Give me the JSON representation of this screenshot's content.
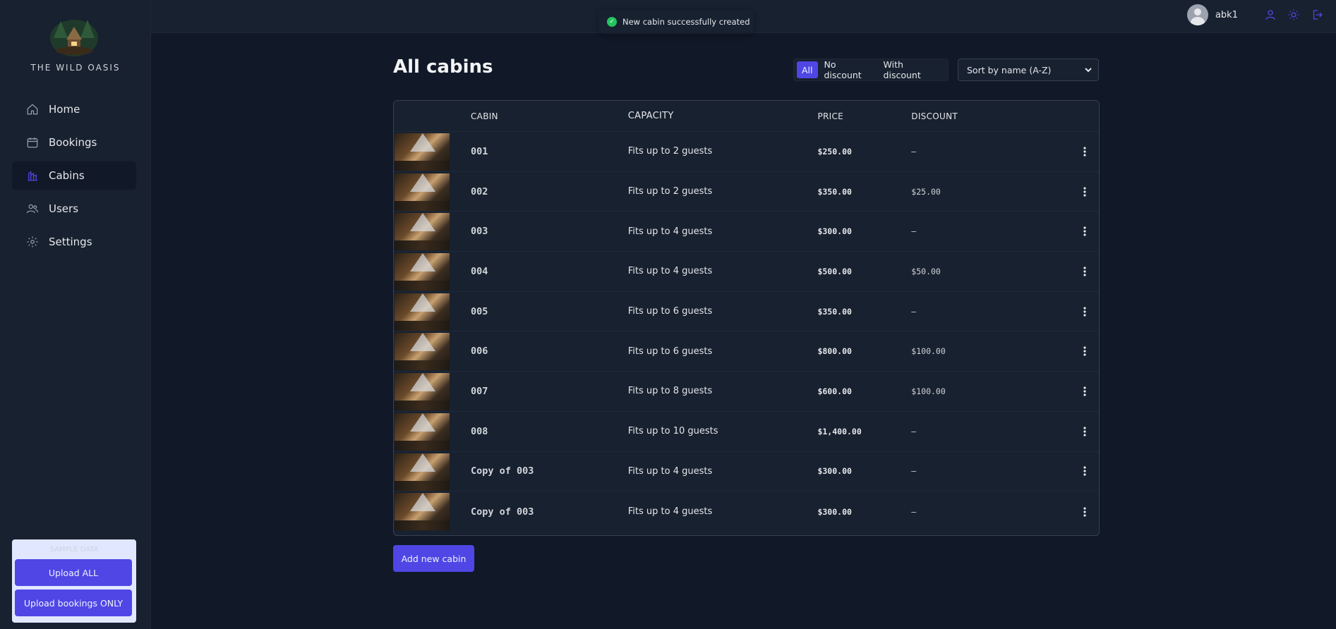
{
  "brand": {
    "name": "THE WILD OASIS"
  },
  "sidebar": {
    "items": [
      {
        "label": "Home",
        "icon": "home-icon",
        "active": false
      },
      {
        "label": "Bookings",
        "icon": "calendar-icon",
        "active": false
      },
      {
        "label": "Cabins",
        "icon": "cabins-icon",
        "active": true
      },
      {
        "label": "Users",
        "icon": "users-icon",
        "active": false
      },
      {
        "label": "Settings",
        "icon": "gear-icon",
        "active": false
      }
    ],
    "upload": {
      "title": "SAMPLE DATA",
      "upload_all": "Upload ALL",
      "upload_bookings": "Upload bookings ONLY"
    }
  },
  "header": {
    "toast": "New cabin successfully created",
    "user_name": "abk1",
    "icons": [
      "user-icon",
      "sun-icon",
      "logout-icon"
    ]
  },
  "main": {
    "title": "All cabins",
    "filter": {
      "options": [
        "All",
        "No discount",
        "With discount"
      ],
      "selected": "All"
    },
    "sort": {
      "selected": "Sort by name (A-Z)"
    },
    "table": {
      "headers": [
        "",
        "CABIN",
        "CAPACITY",
        "PRICE",
        "DISCOUNT",
        ""
      ],
      "rows": [
        {
          "name": "001",
          "capacity": "Fits up to 2 guests",
          "price": "$250.00",
          "discount": "—"
        },
        {
          "name": "002",
          "capacity": "Fits up to 2 guests",
          "price": "$350.00",
          "discount": "$25.00"
        },
        {
          "name": "003",
          "capacity": "Fits up to 4 guests",
          "price": "$300.00",
          "discount": "—"
        },
        {
          "name": "004",
          "capacity": "Fits up to 4 guests",
          "price": "$500.00",
          "discount": "$50.00"
        },
        {
          "name": "005",
          "capacity": "Fits up to 6 guests",
          "price": "$350.00",
          "discount": "—"
        },
        {
          "name": "006",
          "capacity": "Fits up to 6 guests",
          "price": "$800.00",
          "discount": "$100.00"
        },
        {
          "name": "007",
          "capacity": "Fits up to 8 guests",
          "price": "$600.00",
          "discount": "$100.00"
        },
        {
          "name": "008",
          "capacity": "Fits up to 10 guests",
          "price": "$1,400.00",
          "discount": "—"
        },
        {
          "name": "Copy of 003",
          "capacity": "Fits up to 4 guests",
          "price": "$300.00",
          "discount": "—"
        },
        {
          "name": "Copy of 003",
          "capacity": "Fits up to 4 guests",
          "price": "$300.00",
          "discount": "—"
        }
      ]
    },
    "add_button": "Add new cabin"
  },
  "colors": {
    "background": "#111827",
    "panel": "#18212f",
    "accent": "#4f46e5",
    "toast_success": "#22c55e"
  }
}
